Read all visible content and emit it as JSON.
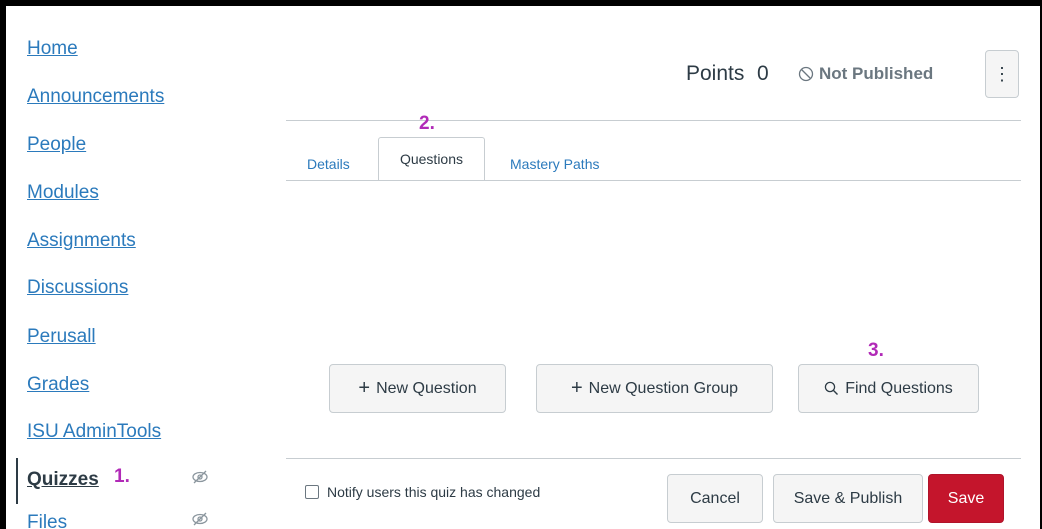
{
  "sidebar": {
    "items": [
      {
        "label": "Home"
      },
      {
        "label": "Announcements"
      },
      {
        "label": "People"
      },
      {
        "label": "Modules"
      },
      {
        "label": "Assignments"
      },
      {
        "label": "Discussions"
      },
      {
        "label": "Perusall"
      },
      {
        "label": "Grades"
      },
      {
        "label": "ISU AdminTools"
      },
      {
        "label": "Quizzes",
        "active": true,
        "hidden_icon": "eye-slash-icon"
      },
      {
        "label": "Files",
        "hidden_icon": "eye-slash-icon"
      }
    ]
  },
  "annotations": {
    "step1": "1.",
    "step2": "2.",
    "step3": "3."
  },
  "header": {
    "points_label": "Points",
    "points_value": "0",
    "publish_status": "Not Published",
    "more_icon": "kebab-icon"
  },
  "tabs": [
    {
      "label": "Details"
    },
    {
      "label": "Questions",
      "active": true
    },
    {
      "label": "Mastery Paths"
    }
  ],
  "actions": {
    "new_question": "New Question",
    "new_question_group": "New Question Group",
    "find_questions": "Find Questions"
  },
  "footer": {
    "notify_label": "Notify users this quiz has changed",
    "notify_checked": false,
    "cancel": "Cancel",
    "save_publish": "Save & Publish",
    "save": "Save"
  },
  "colors": {
    "link": "#2b7abc",
    "annotation": "#b12ab7",
    "save_button": "#c4152c"
  }
}
